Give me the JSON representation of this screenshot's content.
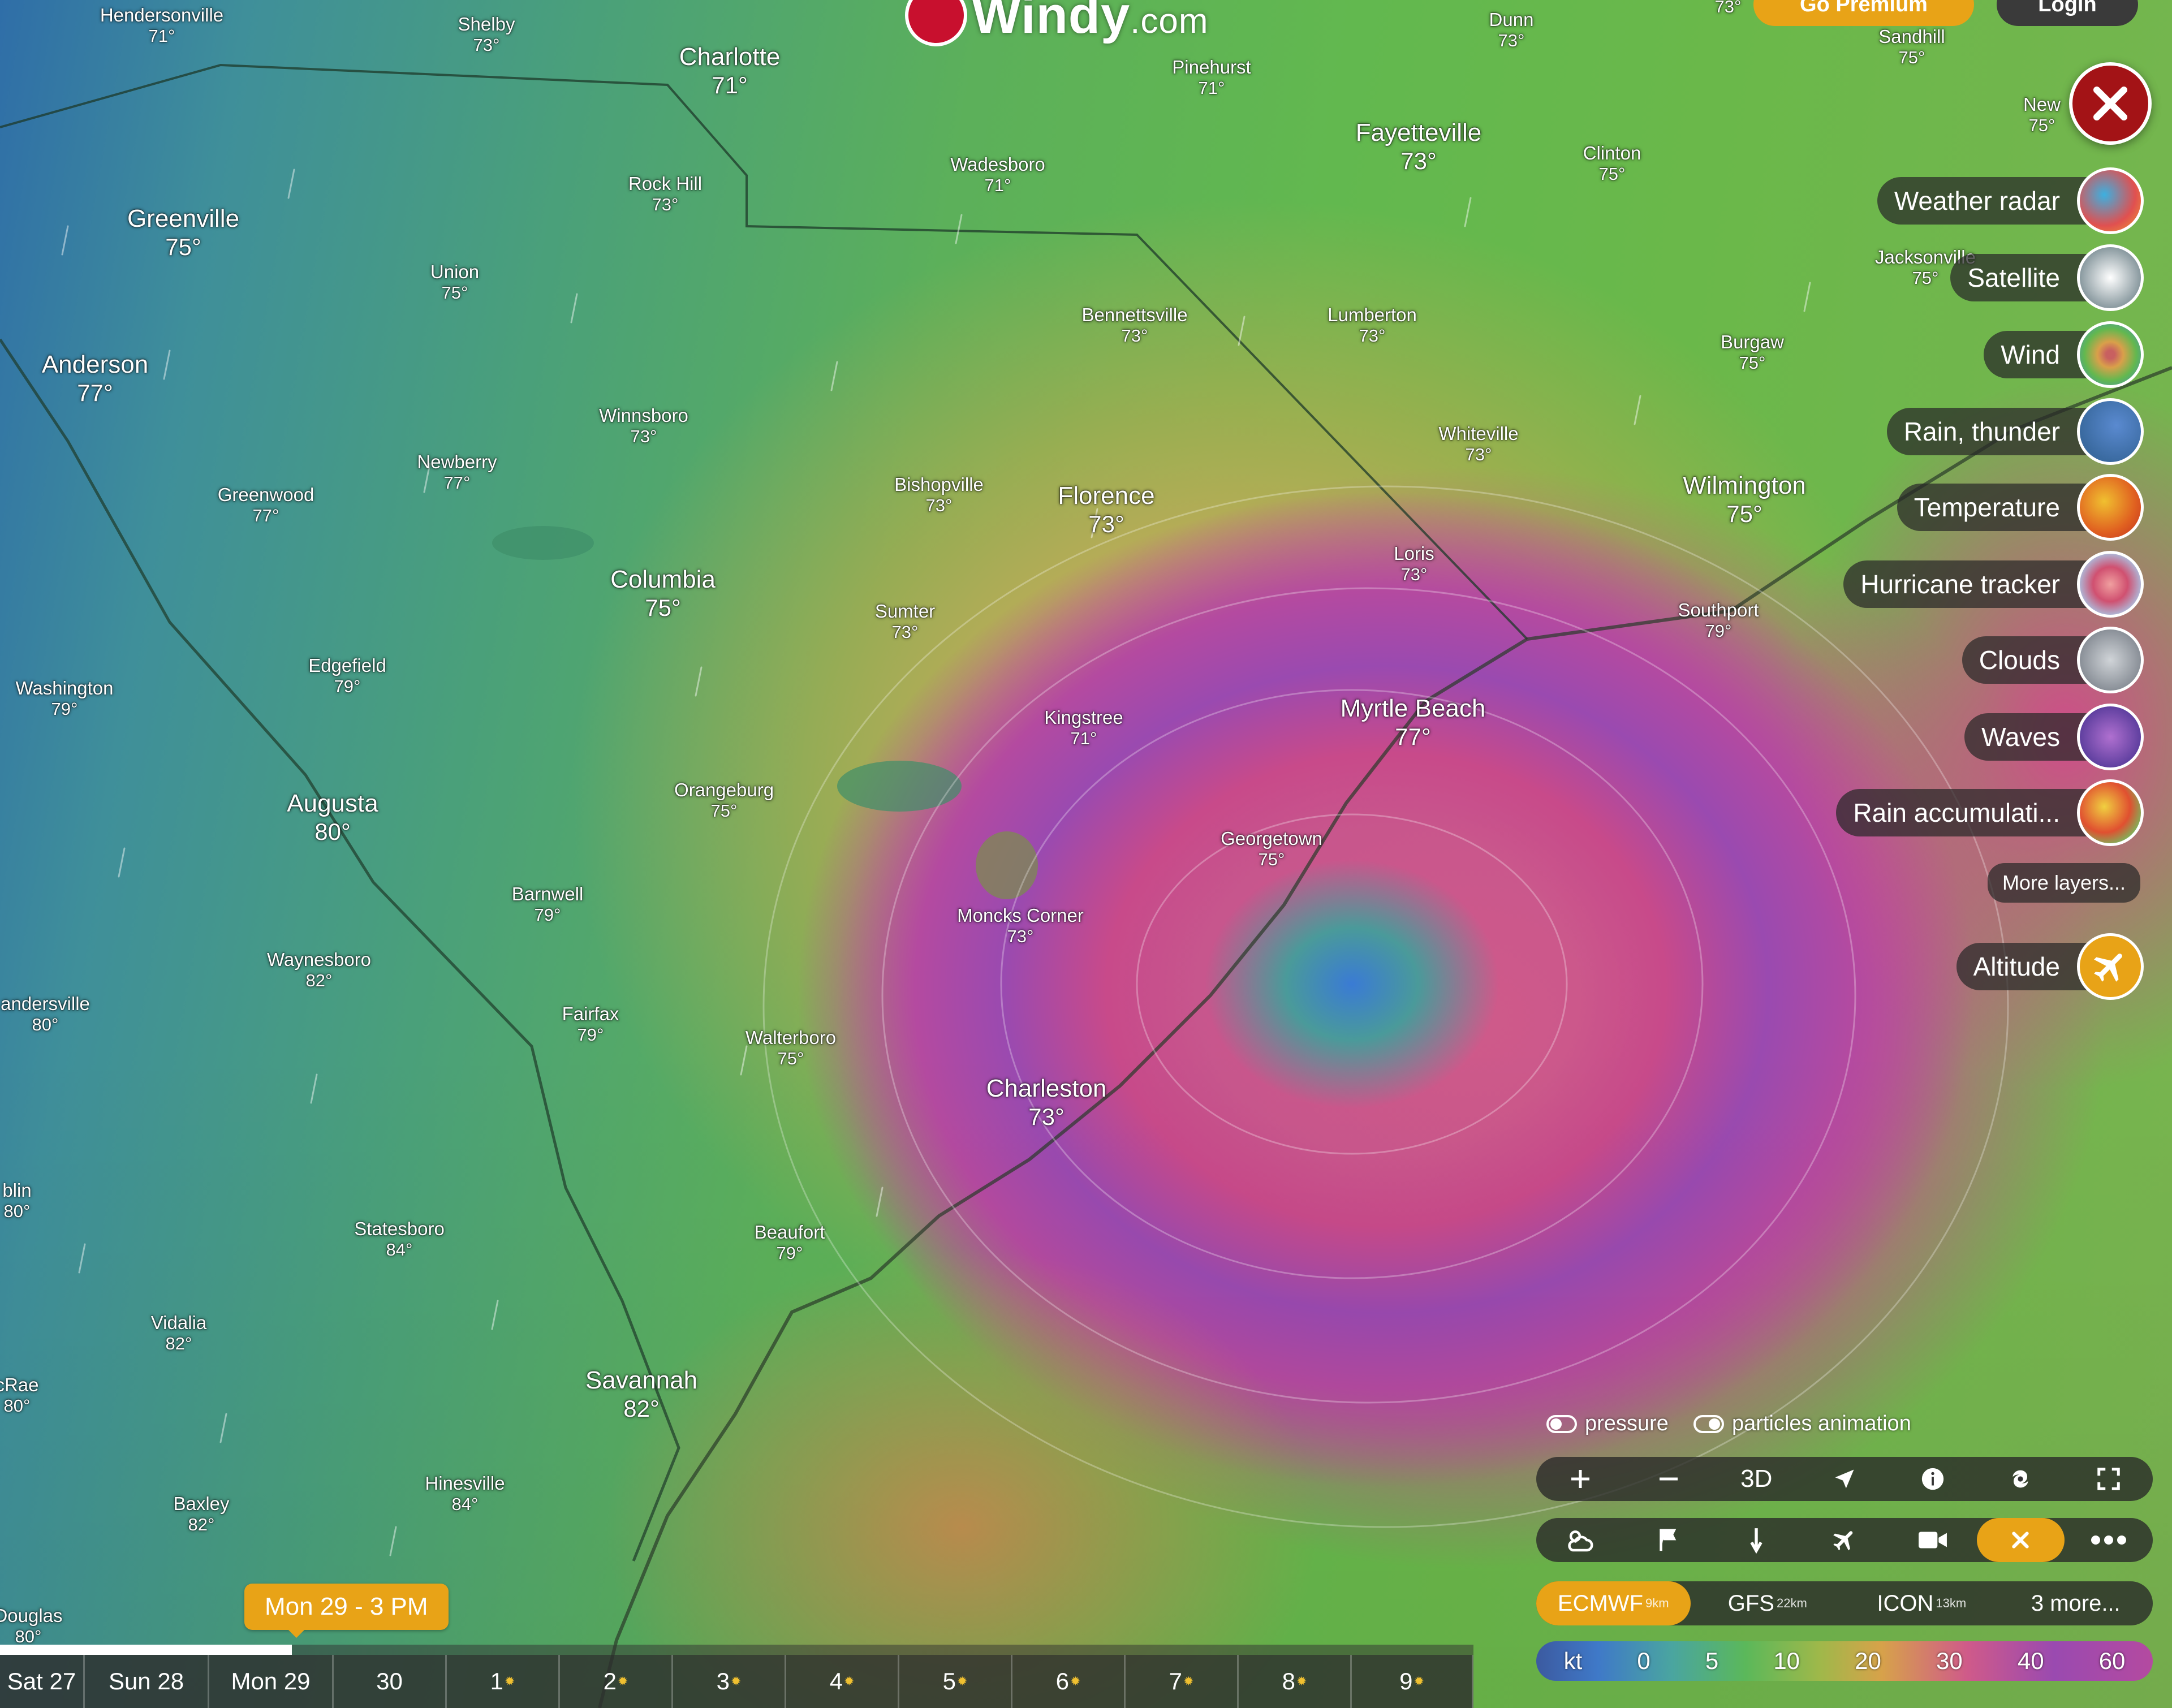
{
  "logo": {
    "brand": "Windy",
    "suffix": ".com"
  },
  "header": {
    "premium_label": "Go Premium",
    "login_label": "Login"
  },
  "cities": [
    {
      "name": "Hendersonville",
      "temp": "71°",
      "size": "small"
    },
    {
      "name": "Shelby",
      "temp": "73°",
      "size": "small"
    },
    {
      "name": "Charlotte",
      "temp": "71°",
      "size": "big"
    },
    {
      "name": "Pinehurst",
      "temp": "71°",
      "size": "small"
    },
    {
      "name": "Dunn",
      "temp": "73°",
      "size": "small"
    },
    {
      "name": "Sandhill",
      "temp": "75°",
      "size": "small"
    },
    {
      "name": "New",
      "temp": "75°",
      "size": "small"
    },
    {
      "name": "Fayetteville",
      "temp": "73°",
      "size": "big"
    },
    {
      "name": "Clinton",
      "temp": "75°",
      "size": "small"
    },
    {
      "name": "Wadesboro",
      "temp": "71°",
      "size": "small"
    },
    {
      "name": "Rock Hill",
      "temp": "73°",
      "size": "small"
    },
    {
      "name": "Greenville",
      "temp": "75°",
      "size": "big"
    },
    {
      "name": "Union",
      "temp": "75°",
      "size": "small"
    },
    {
      "name": "Jacksonville",
      "temp": "75°",
      "size": "small"
    },
    {
      "name": "Bennettsville",
      "temp": "73°",
      "size": "small"
    },
    {
      "name": "Lumberton",
      "temp": "73°",
      "size": "small"
    },
    {
      "name": "Burgaw",
      "temp": "75°",
      "size": "small"
    },
    {
      "name": "Anderson",
      "temp": "77°",
      "size": "big"
    },
    {
      "name": "Winnsboro",
      "temp": "73°",
      "size": "small"
    },
    {
      "name": "Whiteville",
      "temp": "73°",
      "size": "small"
    },
    {
      "name": "Newberry",
      "temp": "77°",
      "size": "small"
    },
    {
      "name": "Greenwood",
      "temp": "77°",
      "size": "small"
    },
    {
      "name": "Bishopville",
      "temp": "73°",
      "size": "small"
    },
    {
      "name": "Florence",
      "temp": "73°",
      "size": "big"
    },
    {
      "name": "Wilmington",
      "temp": "75°",
      "size": "big"
    },
    {
      "name": "Loris",
      "temp": "73°",
      "size": "small"
    },
    {
      "name": "Columbia",
      "temp": "75°",
      "size": "big"
    },
    {
      "name": "Southport",
      "temp": "79°",
      "size": "small"
    },
    {
      "name": "Sumter",
      "temp": "73°",
      "size": "small"
    },
    {
      "name": "Edgefield",
      "temp": "79°",
      "size": "small"
    },
    {
      "name": "Washington",
      "temp": "79°",
      "size": "small"
    },
    {
      "name": "Myrtle Beach",
      "temp": "77°",
      "size": "big"
    },
    {
      "name": "Kingstree",
      "temp": "71°",
      "size": "small"
    },
    {
      "name": "Augusta",
      "temp": "80°",
      "size": "big"
    },
    {
      "name": "Orangeburg",
      "temp": "75°",
      "size": "small"
    },
    {
      "name": "Georgetown",
      "temp": "75°",
      "size": "small"
    },
    {
      "name": "Barnwell",
      "temp": "79°",
      "size": "small"
    },
    {
      "name": "Moncks Corner",
      "temp": "73°",
      "size": "small"
    },
    {
      "name": "Waynesboro",
      "temp": "82°",
      "size": "small"
    },
    {
      "name": "andersville",
      "temp": "80°",
      "size": "small"
    },
    {
      "name": "Fairfax",
      "temp": "79°",
      "size": "small"
    },
    {
      "name": "Walterboro",
      "temp": "75°",
      "size": "small"
    },
    {
      "name": "Charleston",
      "temp": "73°",
      "size": "big"
    },
    {
      "name": "blin",
      "temp": "80°",
      "size": "small"
    },
    {
      "name": "Statesboro",
      "temp": "84°",
      "size": "small"
    },
    {
      "name": "Beaufort",
      "temp": "79°",
      "size": "small"
    },
    {
      "name": "Vidalia",
      "temp": "82°",
      "size": "small"
    },
    {
      "name": "cRae",
      "temp": "80°",
      "size": "small"
    },
    {
      "name": "Savannah",
      "temp": "82°",
      "size": "big"
    },
    {
      "name": "Hinesville",
      "temp": "84°",
      "size": "small"
    },
    {
      "name": "Baxley",
      "temp": "82°",
      "size": "small"
    },
    {
      "name": "Douglas",
      "temp": "80°",
      "size": "small"
    }
  ],
  "top_temp_label": "73°",
  "layers": [
    {
      "label": "Weather radar",
      "icon": "radar-icon"
    },
    {
      "label": "Satellite",
      "icon": "satellite-icon"
    },
    {
      "label": "Wind",
      "icon": "wind-icon"
    },
    {
      "label": "Rain, thunder",
      "icon": "rain-icon"
    },
    {
      "label": "Temperature",
      "icon": "temperature-icon"
    },
    {
      "label": "Hurricane tracker",
      "icon": "hurricane-icon"
    },
    {
      "label": "Clouds",
      "icon": "clouds-icon"
    },
    {
      "label": "Waves",
      "icon": "waves-icon"
    },
    {
      "label": "Rain accumulati...",
      "icon": "rain-accumulation-icon"
    }
  ],
  "more_layers_label": "More layers...",
  "altitude_label": "Altitude",
  "toggles": {
    "pressure": "pressure",
    "particles": "particles animation"
  },
  "controls": {
    "three_d": "3D"
  },
  "models": [
    {
      "name": "ECMWF",
      "res": "9km",
      "active": true
    },
    {
      "name": "GFS",
      "res": "22km",
      "active": false
    },
    {
      "name": "ICON",
      "res": "13km",
      "active": false
    },
    {
      "name": "3 more...",
      "res": "",
      "active": false
    }
  ],
  "legend": {
    "unit": "kt",
    "values": [
      "0",
      "5",
      "10",
      "20",
      "30",
      "40",
      "60"
    ]
  },
  "timeline": {
    "current": "Mon 29 - 3 PM",
    "progress": 0.198,
    "days": [
      {
        "label": "Sat 27",
        "sun": false
      },
      {
        "label": "Sun 28",
        "sun": false
      },
      {
        "label": "Mon 29",
        "sun": false
      },
      {
        "label": "30",
        "sun": false
      },
      {
        "label": "1",
        "sun": true
      },
      {
        "label": "2",
        "sun": true
      },
      {
        "label": "3",
        "sun": true
      },
      {
        "label": "4",
        "sun": true
      },
      {
        "label": "5",
        "sun": true
      },
      {
        "label": "6",
        "sun": true
      },
      {
        "label": "7",
        "sun": true
      },
      {
        "label": "8",
        "sun": true
      },
      {
        "label": "9",
        "sun": true
      }
    ]
  },
  "colors": {
    "accent": "#e8a317",
    "close": "#a31316"
  }
}
